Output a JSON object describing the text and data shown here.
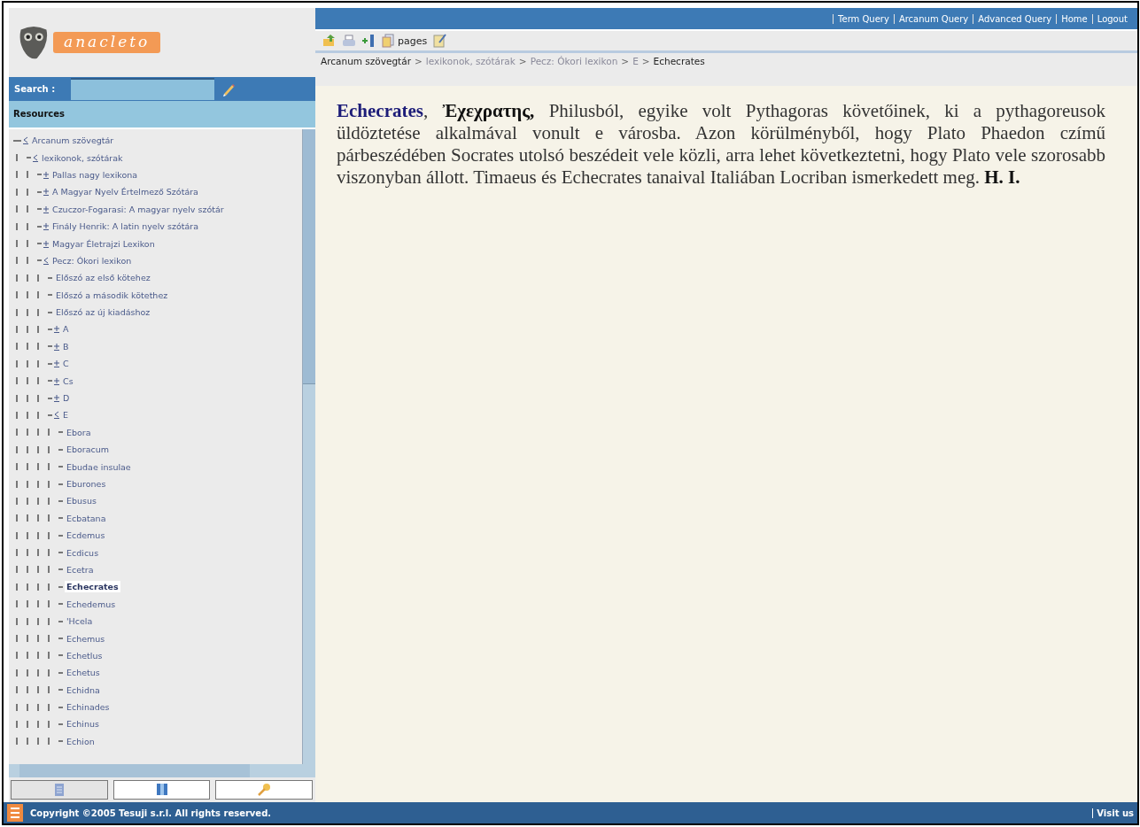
{
  "logo": {
    "text": "anacleto"
  },
  "search": {
    "label": "Search :"
  },
  "resources": {
    "title": "Resources"
  },
  "tree": [
    {
      "label": "Arcanum szövegtár",
      "expanded": true,
      "selected": false,
      "children": [
        {
          "label": "lexikonok, szótárak",
          "expanded": true,
          "selected": false,
          "children": [
            {
              "label": "Pallas nagy lexikona",
              "expanded": false,
              "selected": false
            },
            {
              "label": "A Magyar Nyelv Értelmező Szótára",
              "expanded": false,
              "selected": false
            },
            {
              "label": "Czuczor-Fogarasi: A magyar nyelv szótár",
              "expanded": false,
              "selected": false
            },
            {
              "label": "Finály Henrik: A latin nyelv szótára",
              "expanded": false,
              "selected": false
            },
            {
              "label": "Magyar Életrajzi Lexikon",
              "expanded": false,
              "selected": false
            },
            {
              "label": "Pecz: Ókori lexikon",
              "expanded": true,
              "selected": false,
              "children": [
                {
                  "label": "Előszó az első kötehez",
                  "selected": false
                },
                {
                  "label": "Előszó a második kötethez",
                  "selected": false
                },
                {
                  "label": "Előszó az új kiadáshoz",
                  "selected": false
                },
                {
                  "label": "A",
                  "expanded": false,
                  "selected": false
                },
                {
                  "label": "B",
                  "expanded": false,
                  "selected": false
                },
                {
                  "label": "C",
                  "expanded": false,
                  "selected": false
                },
                {
                  "label": "Cs",
                  "expanded": false,
                  "selected": false
                },
                {
                  "label": "D",
                  "expanded": false,
                  "selected": false
                },
                {
                  "label": "E",
                  "expanded": true,
                  "selected": false,
                  "children": [
                    {
                      "label": "Ebora",
                      "selected": false
                    },
                    {
                      "label": "Eboracum",
                      "selected": false
                    },
                    {
                      "label": "Ebudae insulae",
                      "selected": false
                    },
                    {
                      "label": "Eburones",
                      "selected": false
                    },
                    {
                      "label": "Ebusus",
                      "selected": false
                    },
                    {
                      "label": "Ecbatana",
                      "selected": false
                    },
                    {
                      "label": "Ecdemus",
                      "selected": false
                    },
                    {
                      "label": "Ecdicus",
                      "selected": false
                    },
                    {
                      "label": "Ecetra",
                      "selected": false
                    },
                    {
                      "label": "Echecrates",
                      "selected": true
                    },
                    {
                      "label": "Echedemus",
                      "selected": false
                    },
                    {
                      "label": "'Hcela",
                      "selected": false
                    },
                    {
                      "label": "Echemus",
                      "selected": false
                    },
                    {
                      "label": "Echetlus",
                      "selected": false
                    },
                    {
                      "label": "Echetus",
                      "selected": false
                    },
                    {
                      "label": "Echidna",
                      "selected": false
                    },
                    {
                      "label": "Echinades",
                      "selected": false
                    },
                    {
                      "label": "Echinus",
                      "selected": false
                    },
                    {
                      "label": "Echion",
                      "selected": false
                    }
                  ]
                }
              ]
            }
          ]
        }
      ]
    }
  ],
  "panel_tabs": [
    {
      "selected": true
    },
    {
      "selected": false
    },
    {
      "selected": false
    }
  ],
  "top_nav": [
    "Term Query",
    "Arcanum Query",
    "Advanced Query",
    "Home",
    "Logout"
  ],
  "toolbar": {
    "pages_label": "pages"
  },
  "breadcrumb": {
    "separator": ">",
    "items": [
      {
        "label": "Arcanum szövegtár",
        "kind": "root"
      },
      {
        "label": "lexikonok, szótárak",
        "kind": "link"
      },
      {
        "label": "Pecz: Ókori lexikon",
        "kind": "link"
      },
      {
        "label": "E",
        "kind": "link"
      },
      {
        "label": "Echecrates",
        "kind": "current"
      }
    ]
  },
  "article": {
    "text": "**Echecrates**, **Ἐχεχρατης,** Philusból, egyike volt Pythagoras követőinek, ki a pythagoreusok üldöztetése alkalmával vonult e városba. Azon körülményből, hogy Plato Phaedon czímű párbeszédében Socrates utolsó beszédeit vele közli, arra lehet következtetni, hogy Plato vele szorosabb viszonyban állott. Timaeus és Echecrates tanaival Italiában Locriban ismerkedett meg. **H. I.**"
  },
  "footer": {
    "copyright": "Copyright ©2005 Tesuji s.r.l. All rights reserved.",
    "link": "Visit us"
  }
}
